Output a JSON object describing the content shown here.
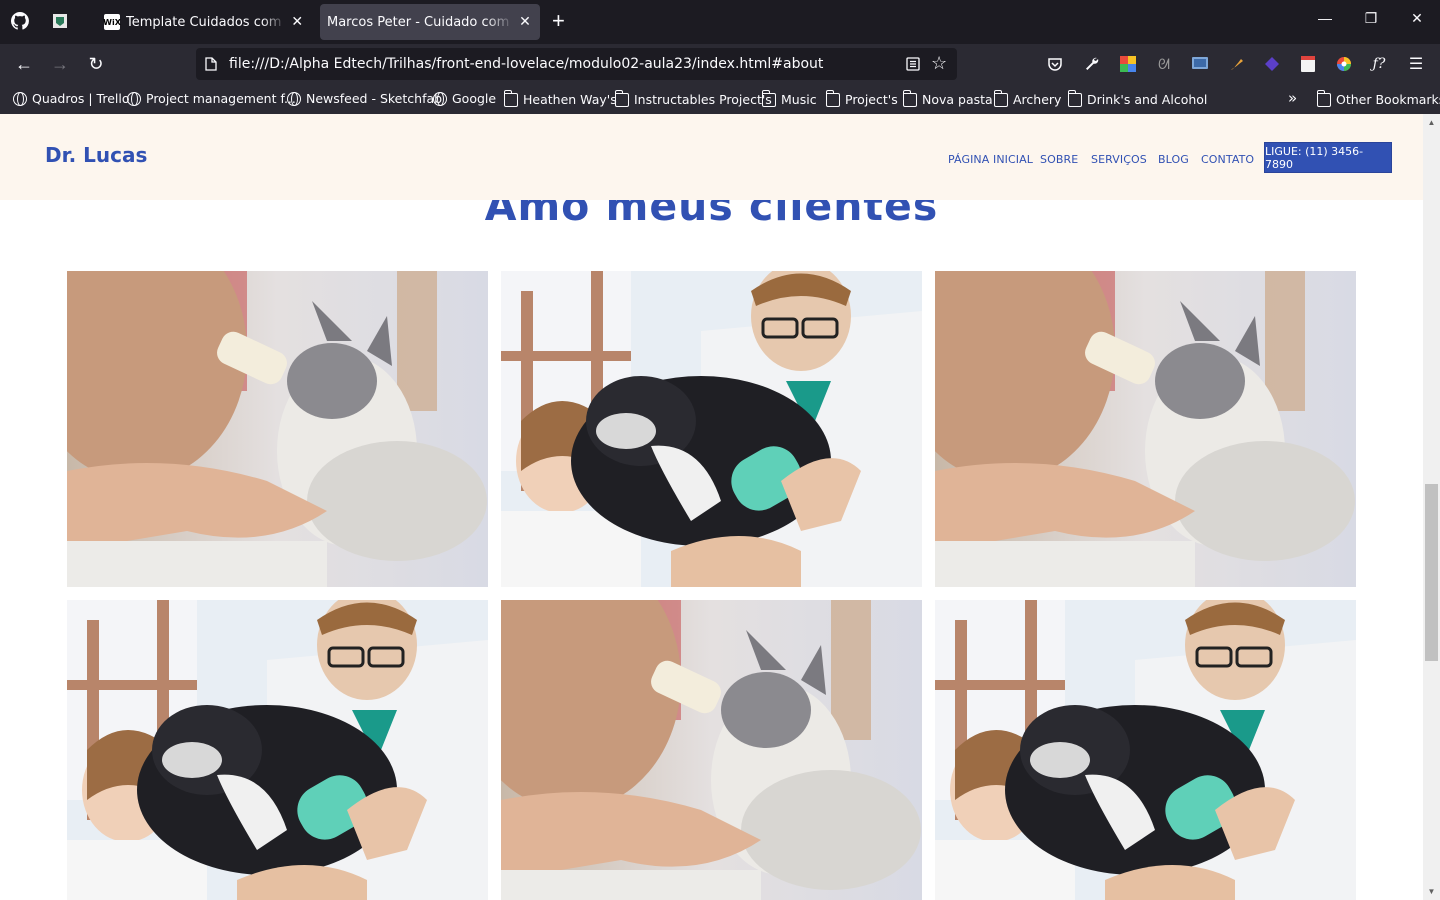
{
  "browser": {
    "tabs": [
      {
        "title": "Template Cuidados com Animais",
        "favicon": "WiX",
        "active": false
      },
      {
        "title": "Marcos Peter - Cuidado com Animais",
        "favicon": "",
        "active": true
      }
    ],
    "url": "file:///D:/Alpha Edtech/Trilhas/front-end-lovelace/modulo02-aula23/index.html#about",
    "bookmarks": [
      {
        "label": "Quadros | Trello",
        "icon": "globe"
      },
      {
        "label": "Project management f...",
        "icon": "globe"
      },
      {
        "label": "Newsfeed - Sketchfab",
        "icon": "globe"
      },
      {
        "label": "Google",
        "icon": "globe"
      },
      {
        "label": "Heathen Way's",
        "icon": "folder"
      },
      {
        "label": "Instructables Project's",
        "icon": "folder"
      },
      {
        "label": "Music",
        "icon": "folder"
      },
      {
        "label": "Project's",
        "icon": "folder"
      },
      {
        "label": "Nova pasta",
        "icon": "folder"
      },
      {
        "label": "Archery",
        "icon": "folder"
      },
      {
        "label": "Drink's and Alcohol",
        "icon": "folder"
      }
    ],
    "other_bookmarks": "Other Bookmarks"
  },
  "site": {
    "logo": "Dr. Lucas",
    "menu": [
      "PÁGINA INICIAL",
      "SOBRE",
      "SERVIÇOS",
      "BLOG",
      "CONTATO"
    ],
    "cta": "LIGUE: (11) 3456-7890",
    "section_title": "Amo meus clientes",
    "gallery": [
      "kitten-bottle-feeding",
      "vet-dog-scanner",
      "kitten-bottle-feeding",
      "vet-dog-scanner",
      "kitten-bottle-feeding",
      "vet-dog-scanner"
    ]
  },
  "colors": {
    "brand_blue": "#3151b3",
    "header_bg": "#fdf6ee",
    "chrome_dark": "#1c1b22",
    "chrome_mid": "#2b2a33"
  }
}
